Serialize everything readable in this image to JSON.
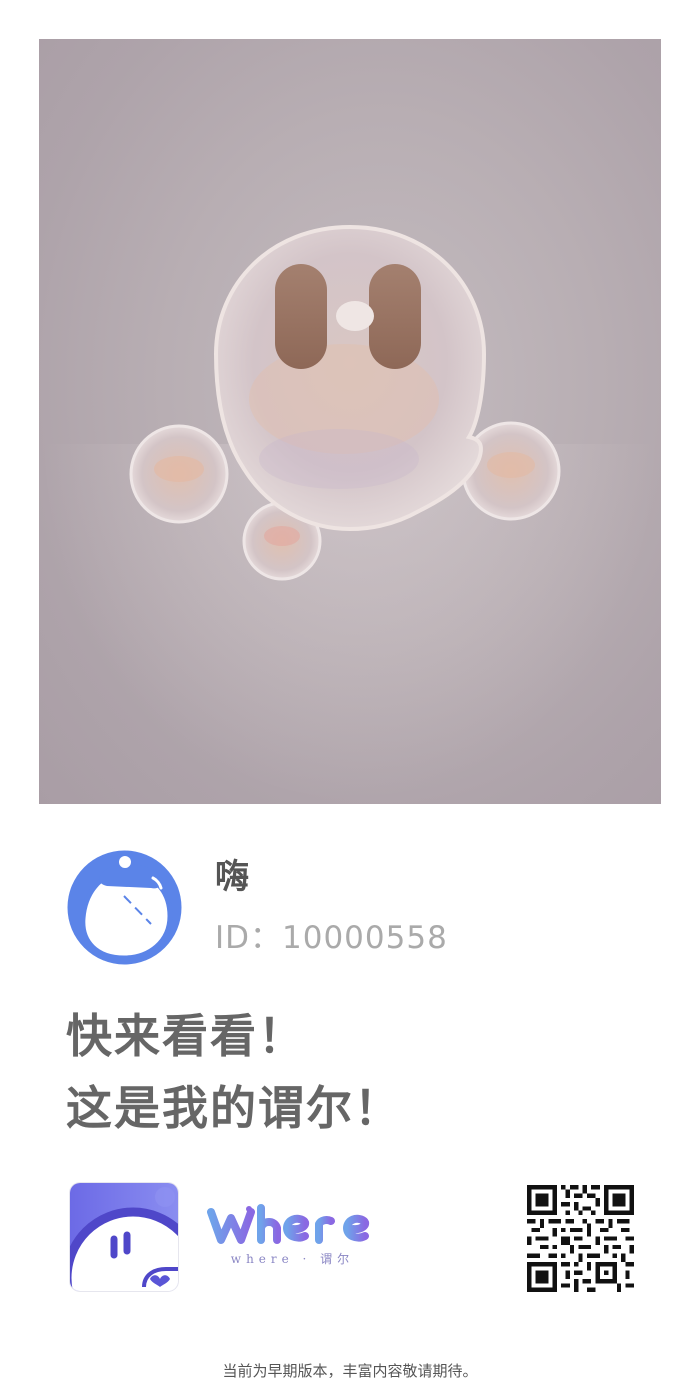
{
  "hero": {
    "image_icon": "bubble-character-illustration"
  },
  "profile": {
    "avatar_icon": "bubble-avatar-icon",
    "nickname": "嗨",
    "id_text": "ID：10000558"
  },
  "message": {
    "line1": "快来看看！",
    "line2": "这是我的谓尔！"
  },
  "brand": {
    "app_icon": "where-app-icon",
    "wordmark": "Where",
    "subtitle": "where · 谓尔",
    "qr_icon": "qr-code"
  },
  "footer": {
    "note": "当前为早期版本，丰富内容敬请期待。"
  },
  "colors": {
    "accent_blue": "#5b84e8",
    "brand_purple": "#7b73e0",
    "text_dark": "#555555",
    "text_muted": "#aaaaaa"
  }
}
